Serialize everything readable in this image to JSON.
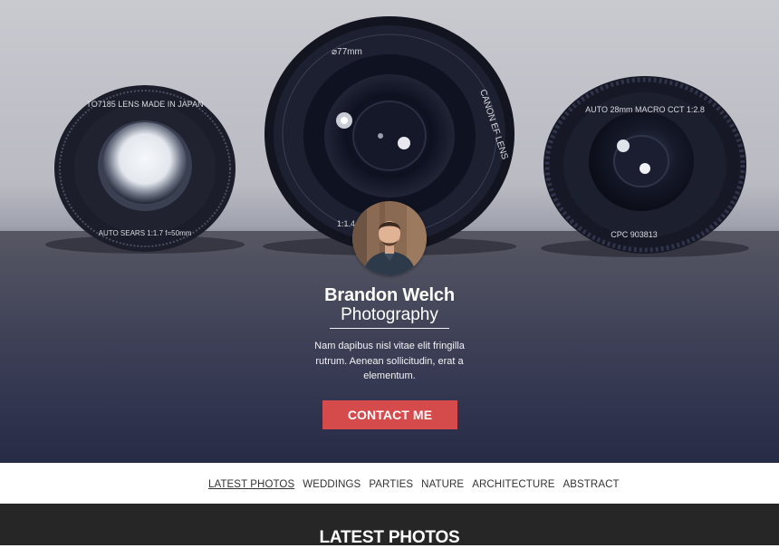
{
  "hero": {
    "name": "Brandon Welch",
    "subtitle": "Photography",
    "description": "Nam dapibus nisl vitae elit fringilla rutrum. Aenean sollicitudin, erat a elementum.",
    "button_label": "CONTACT ME",
    "lens_left_text_top": "TO7185 LENS MADE IN JAPAN",
    "lens_left_text_bottom": "AUTO SEARS 1:1.7 f=50mm",
    "lens_center_text_top": "⌀77mm",
    "lens_center_text_right": "CANON EF LENS",
    "lens_center_text_bottom": "1:1.4",
    "lens_right_text_top": "AUTO 28mm MACRO CCT 1:2.8",
    "lens_right_text_bottom": "CPC 903813"
  },
  "nav": {
    "items": [
      {
        "label": "LATEST PHOTOS",
        "active": true
      },
      {
        "label": "WEDDINGS",
        "active": false
      },
      {
        "label": "PARTIES",
        "active": false
      },
      {
        "label": "NATURE",
        "active": false
      },
      {
        "label": "ARCHITECTURE",
        "active": false
      },
      {
        "label": "ABSTRACT",
        "active": false
      }
    ]
  },
  "section": {
    "title": "LATEST PHOTOS"
  },
  "colors": {
    "accent_button": "#d54a4a",
    "dark_section": "#262626",
    "hero_dark": "#2b2e4a"
  }
}
